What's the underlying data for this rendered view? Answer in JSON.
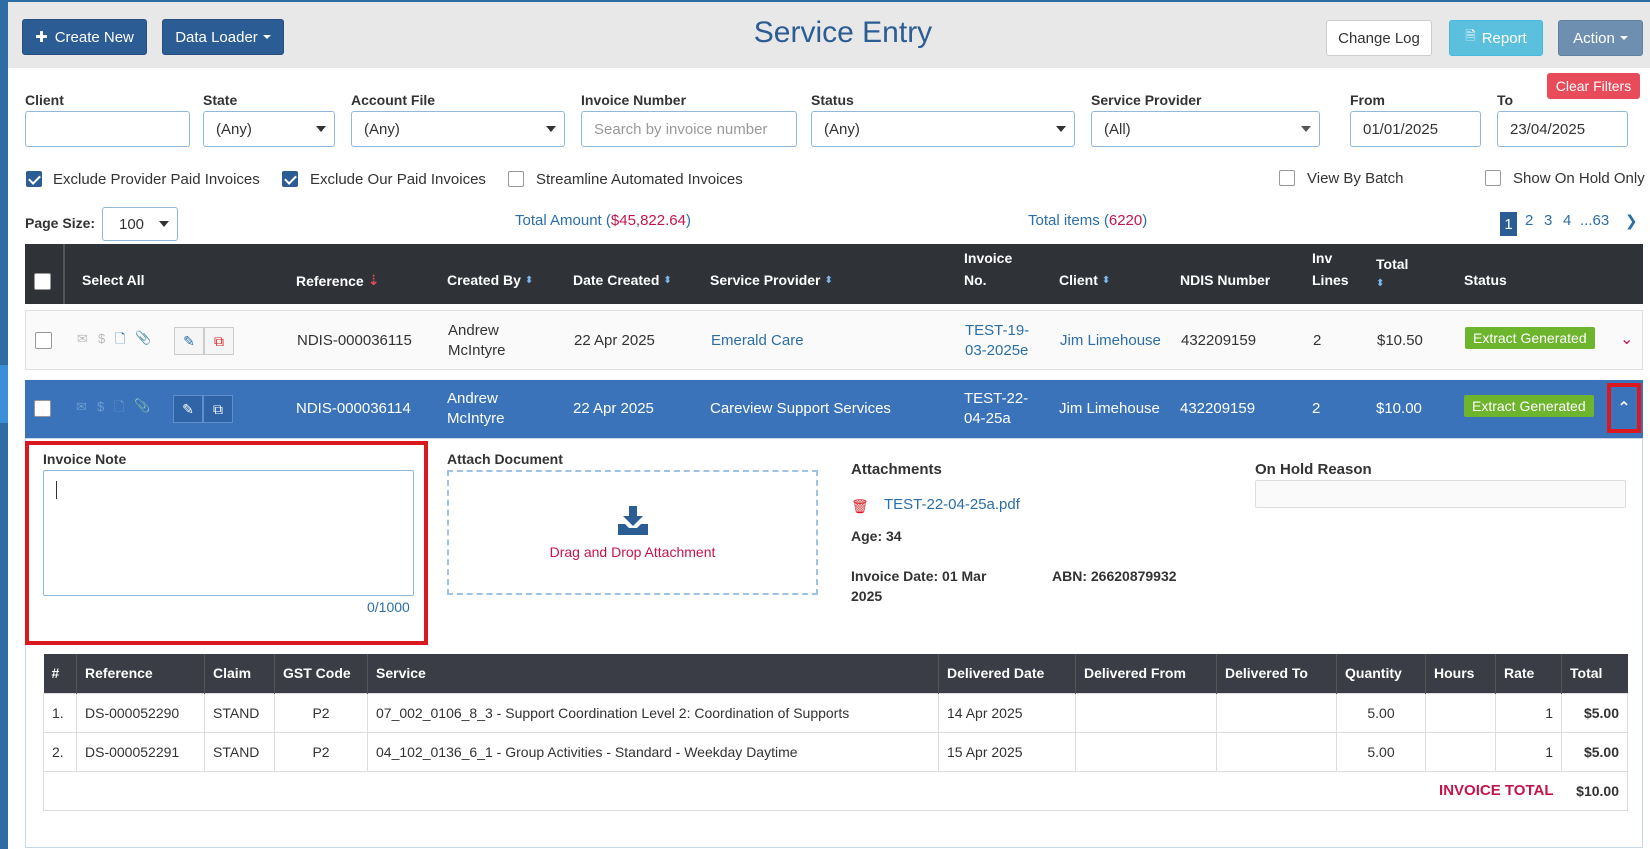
{
  "header": {
    "title": "Service Entry",
    "create_new": "Create New",
    "data_loader": "Data Loader",
    "change_log": "Change Log",
    "report": "Report",
    "action": "Action"
  },
  "filters": {
    "clear": "Clear Filters",
    "client_label": "Client",
    "client_value": "",
    "state_label": "State",
    "state_value": "(Any)",
    "account_label": "Account File",
    "account_value": "(Any)",
    "invoice_label": "Invoice Number",
    "invoice_placeholder": "Search by invoice number",
    "status_label": "Status",
    "status_value": "(Any)",
    "provider_label": "Service Provider",
    "provider_value": "(All)",
    "from_label": "From",
    "from_value": "01/01/2025",
    "to_label": "To",
    "to_value": "23/04/2025"
  },
  "options": {
    "exclude_provider": "Exclude Provider Paid Invoices",
    "exclude_ours": "Exclude Our Paid Invoices",
    "streamline": "Streamline Automated Invoices",
    "view_batch": "View By Batch",
    "on_hold": "Show On Hold Only"
  },
  "summary": {
    "page_size_label": "Page Size:",
    "page_size": "100",
    "total_amount_label": "Total Amount (",
    "total_amount": "$45,822.64",
    "total_items_label": "Total items (",
    "total_items": "6220",
    "close_paren": ")",
    "pages": [
      "1",
      "2",
      "3",
      "4",
      "...63"
    ]
  },
  "table": {
    "headers": {
      "select_all": "Select All",
      "reference": "Reference",
      "created_by": "Created By",
      "date_created": "Date Created",
      "provider": "Service Provider",
      "invoice_no_1": "Invoice",
      "invoice_no_2": "No.",
      "client": "Client",
      "ndis": "NDIS Number",
      "inv_lines_1": "Inv",
      "inv_lines_2": "Lines",
      "total": "Total",
      "status": "Status"
    },
    "rows": [
      {
        "reference": "NDIS-000036115",
        "created_by_1": "Andrew",
        "created_by_2": "McIntyre",
        "date": "22 Apr 2025",
        "provider": "Emerald Care",
        "invoice_1": "TEST-19-",
        "invoice_2": "03-2025e",
        "client": "Jim Limehouse",
        "ndis": "432209159",
        "lines": "2",
        "total": "$10.50",
        "status": "Extract Generated"
      },
      {
        "reference": "NDIS-000036114",
        "created_by_1": "Andrew",
        "created_by_2": "McIntyre",
        "date": "22 Apr 2025",
        "provider": "Careview Support Services",
        "invoice_1": "TEST-22-",
        "invoice_2": "04-25a",
        "client": "Jim Limehouse",
        "ndis": "432209159",
        "lines": "2",
        "total": "$10.00",
        "status": "Extract Generated"
      }
    ]
  },
  "detail": {
    "invoice_note_label": "Invoice Note",
    "note_counter": "0/1000",
    "attach_label": "Attach Document",
    "drop_text": "Drag and Drop Attachment",
    "attachments_label": "Attachments",
    "attachment_file": "TEST-22-04-25a.pdf",
    "age": "Age: 34",
    "invoice_date_1": "Invoice Date: 01 Mar",
    "invoice_date_2": "2025",
    "abn": "ABN: 26620879932",
    "on_hold_label": "On Hold Reason",
    "on_hold_value": ""
  },
  "lines": {
    "headers": [
      "#",
      "Reference",
      "Claim",
      "GST Code",
      "Service",
      "Delivered Date",
      "Delivered From",
      "Delivered To",
      "Quantity",
      "Hours",
      "Rate",
      "Total"
    ],
    "rows": [
      [
        "1.",
        "DS-000052290",
        "STAND",
        "P2",
        "07_002_0106_8_3 - Support Coordination Level 2: Coordination of Supports",
        "14 Apr 2025",
        "",
        "",
        "5.00",
        "",
        "1",
        "$5.00"
      ],
      [
        "2.",
        "DS-000052291",
        "STAND",
        "P2",
        "04_102_0136_6_1 - Group Activities - Standard - Weekday Daytime",
        "15 Apr 2025",
        "",
        "",
        "5.00",
        "",
        "1",
        "$5.00"
      ]
    ],
    "invoice_total_label": "INVOICE TOTAL",
    "invoice_total": "$10.00"
  }
}
